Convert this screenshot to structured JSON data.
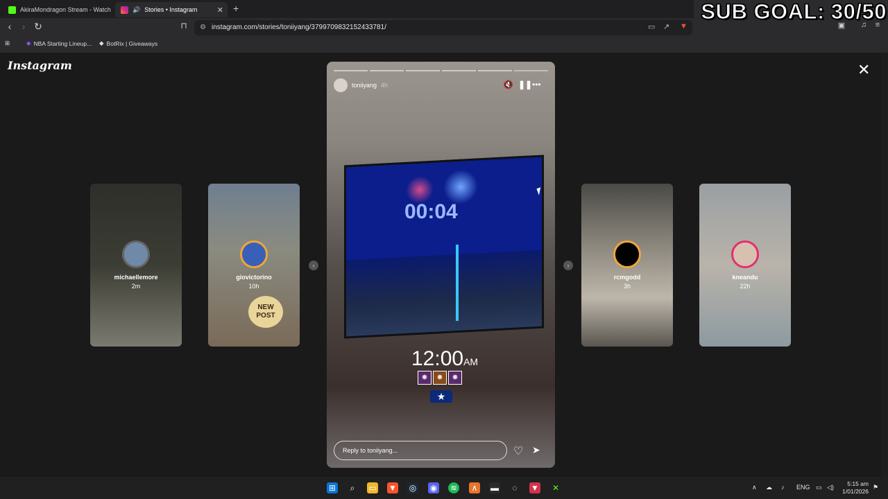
{
  "browser": {
    "tabs": [
      {
        "title": "AkiraMondragon Stream - Watch Liv"
      },
      {
        "title": "Stories • Instagram"
      }
    ],
    "url": "instagram.com/stories/toniiyang/3799709832152433781/",
    "bookmarks": [
      "NBA Starting Lineup...",
      "BotRix | Giveaways"
    ]
  },
  "overlay": {
    "sub_goal": "SUB GOAL: 30/50"
  },
  "instagram": {
    "logo": "Instagram",
    "story": {
      "username": "toniiyang",
      "age": "4h",
      "countdown": "00:04",
      "clock": "12:00",
      "clock_suffix": "AM",
      "reply_placeholder": "Reply to toniiyang...",
      "progress_segments": 6,
      "progress_filled": 5
    },
    "side_stories": [
      {
        "name": "michaellemore",
        "time": "2m"
      },
      {
        "name": "giovictorino",
        "time": "10h",
        "badge": "NEW POST"
      },
      {
        "name": "rcmgodd",
        "time": "3h"
      },
      {
        "name": "kneandu",
        "time": "22h"
      }
    ]
  },
  "taskbar": {
    "lang": "ENG",
    "time": "5:15 am",
    "date": "1/01/2026"
  }
}
